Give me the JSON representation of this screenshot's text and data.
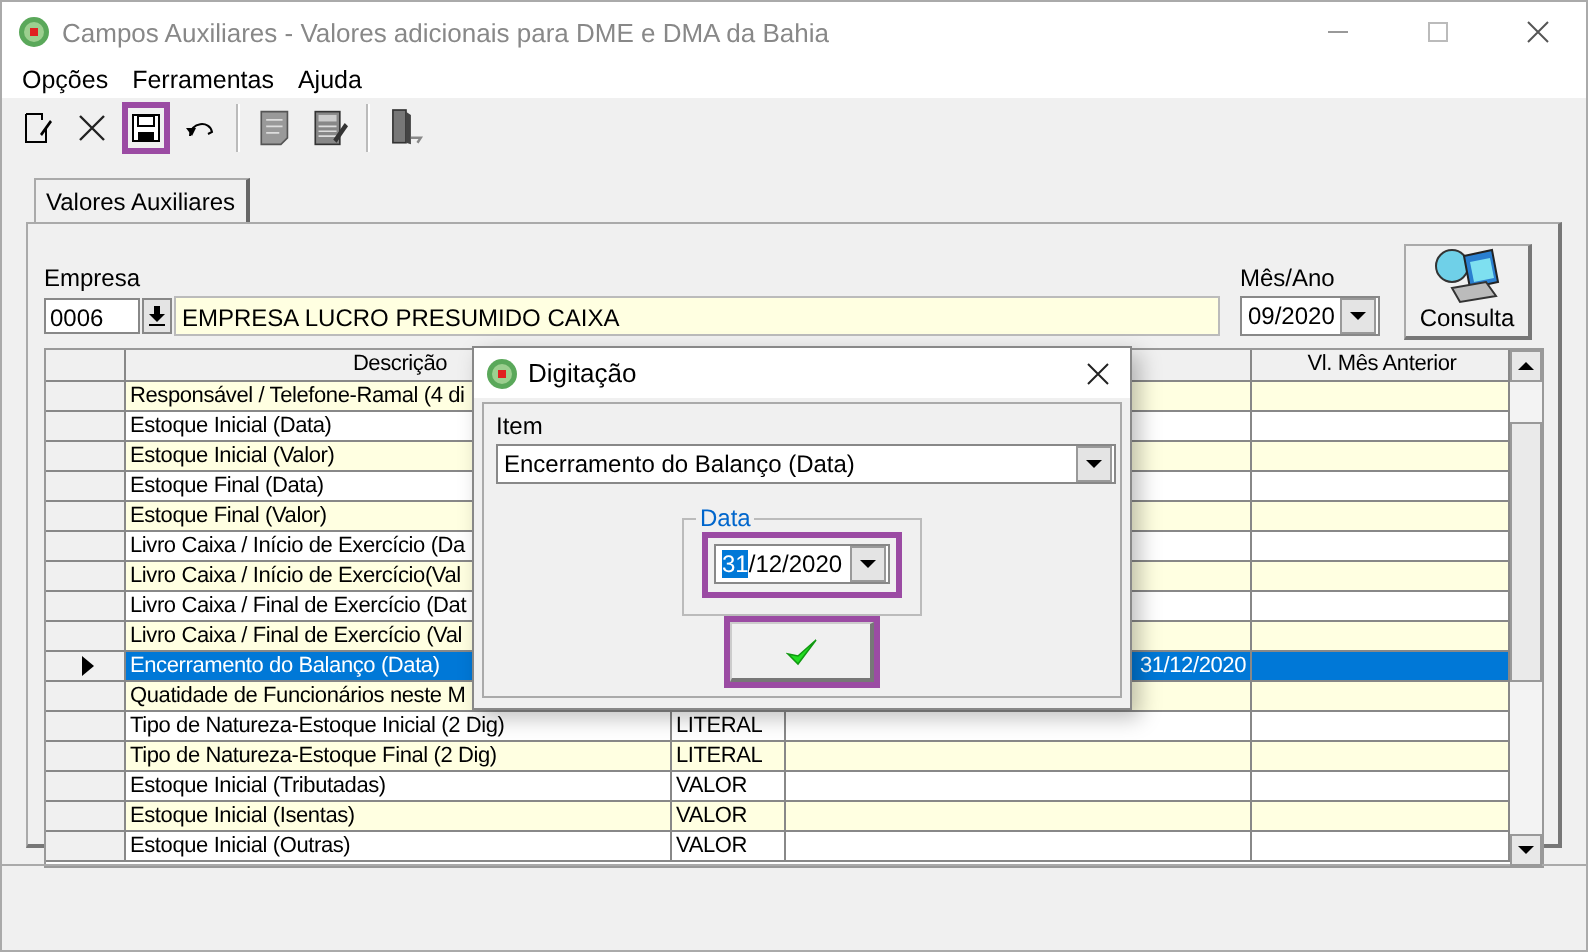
{
  "window": {
    "title": "Campos Auxiliares - Valores adicionais para DME e DMA da Bahia"
  },
  "menu": [
    "Opções",
    "Ferramentas",
    "Ajuda"
  ],
  "toolbar": [
    {
      "kind": "new",
      "highlighted": false
    },
    {
      "kind": "delete",
      "highlighted": false
    },
    {
      "kind": "save",
      "highlighted": true
    },
    {
      "kind": "undo",
      "highlighted": false
    },
    {
      "kind": "separator",
      "highlighted": false
    },
    {
      "kind": "memo",
      "highlighted": false
    },
    {
      "kind": "calc",
      "highlighted": false
    },
    {
      "kind": "separator",
      "highlighted": false
    },
    {
      "kind": "exit",
      "highlighted": false
    }
  ],
  "tabs": [
    {
      "label": "Valores Auxiliares",
      "selected": true
    }
  ],
  "empresa": {
    "label": "Empresa",
    "code": "0006",
    "name": "EMPRESA LUCRO PRESUMIDO CAIXA"
  },
  "mes_ano": {
    "label": "Mês/Ano",
    "value": "09/2020"
  },
  "consulta_button": "Consulta",
  "table": {
    "columns": {
      "descricao": "Descrição",
      "vl_mes_anterior": "Vl. Mês Anterior"
    },
    "rows": [
      {
        "descricao": "Responsável / Telefone-Ramal (4 di",
        "selected": false
      },
      {
        "descricao": "Estoque Inicial (Data)",
        "selected": false
      },
      {
        "descricao": "Estoque Inicial (Valor)",
        "selected": false
      },
      {
        "descricao": "Estoque Final (Data)",
        "selected": false
      },
      {
        "descricao": "Estoque Final (Valor)",
        "selected": false
      },
      {
        "descricao": "Livro Caixa / Início de Exercício (Da",
        "selected": false
      },
      {
        "descricao": "Livro Caixa / Início de Exercício(Val",
        "selected": false
      },
      {
        "descricao": "Livro Caixa / Final de Exercício (Dat",
        "selected": false
      },
      {
        "descricao": "Livro Caixa / Final de Exercício (Val",
        "selected": false
      },
      {
        "descricao": "Encerramento do Balanço (Data)",
        "valor": "31/12/2020",
        "selected": true
      },
      {
        "descricao": "Quatidade de Funcionários neste M",
        "selected": false
      },
      {
        "descricao": "Tipo de Natureza-Estoque Inicial (2 Dig)",
        "tipo": "LITERAL",
        "selected": false
      },
      {
        "descricao": "Tipo de Natureza-Estoque Final (2 Dig)",
        "tipo": "LITERAL",
        "selected": false
      },
      {
        "descricao": "Estoque Inicial (Tributadas)",
        "tipo": "VALOR",
        "selected": false
      },
      {
        "descricao": "Estoque Inicial (Isentas)",
        "tipo": "VALOR",
        "selected": false
      },
      {
        "descricao": "Estoque Inicial (Outras)",
        "tipo": "VALOR",
        "selected": false
      }
    ]
  },
  "dialog": {
    "title": "Digitação",
    "item_label": "Item",
    "item_value": "Encerramento do Balanço (Data)",
    "group_label": "Data",
    "date_selected_text": "31",
    "date_text": "/12/2020",
    "date_highlighted": true,
    "ok_highlighted": true
  }
}
